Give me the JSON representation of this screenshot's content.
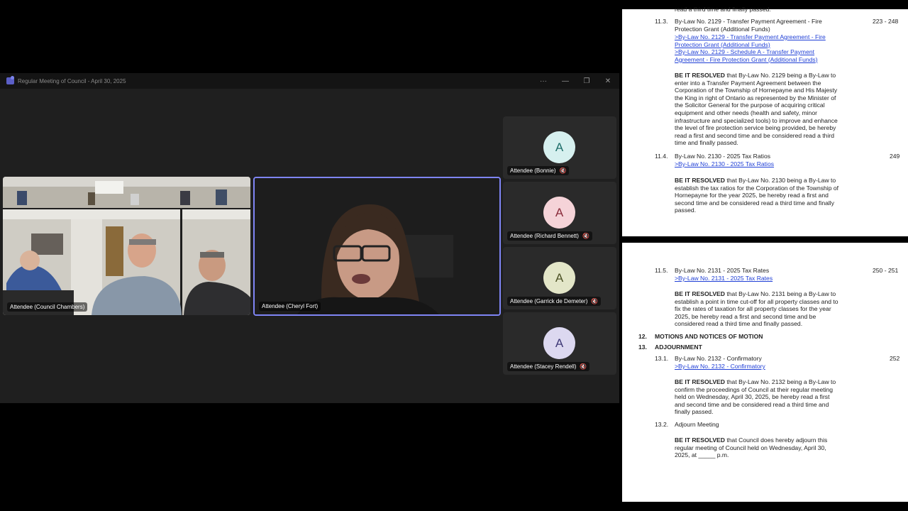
{
  "window": {
    "title": "Regular Meeting of Council - April 30, 2025",
    "controls": [
      "···",
      "—",
      "❐",
      "✕"
    ]
  },
  "tiles": {
    "chambers": {
      "name": "Attendee (Council Chambers)"
    },
    "cheryl": {
      "name": "Attendee (Cheryl Fort)"
    }
  },
  "side_tiles": [
    {
      "name": "Attendee (Bonnie)",
      "initial": "A",
      "avatar_bg": "#d6f0ef",
      "avatar_fg": "#1f6e6a"
    },
    {
      "name": "Attendee (Richard Bennett)",
      "initial": "A",
      "avatar_bg": "#f5d3d8",
      "avatar_fg": "#8a2c3b"
    },
    {
      "name": "Attendee (Garrick de Demeter)",
      "initial": "A",
      "avatar_bg": "#e3e6c8",
      "avatar_fg": "#4d5226"
    },
    {
      "name": "Attendee (Stacey Rendell)",
      "initial": "A",
      "avatar_bg": "#dcd8f0",
      "avatar_fg": "#403a78"
    }
  ],
  "doc_top": {
    "cut_line": "read a third time and finally passed.",
    "item_11_3": {
      "num": "11.3.",
      "title_1": "By-Law No. 2129 - Transfer Payment Agreement - Fire",
      "title_2": "Protection Grant (Additional Funds)",
      "pages": "223 - 248",
      "link1_1": ">By-Law No. 2129 - Transfer Payment Agreement - Fire",
      "link1_2": "Protection Grant (Additional Funds)",
      "link2_1": ">By-Law No. 2129 - Schedule A - Transfer Payment",
      "link2_2": "Agreement - Fire Protection Grant (Additional Funds)",
      "res_bold": "BE IT RESOLVED",
      "res_1": " that By-Law No. 2129 being a By-Law to",
      "res_lines": [
        "enter into a Transfer Payment Agreement between the",
        "Corporation of the Township of Hornepayne and His Majesty",
        "the King in right of Ontario as represented by the Minister of",
        "the Solicitor General for the purpose of acquiring critical",
        "equipment and other needs (health and safety, minor",
        "infrastructure and specialized tools) to improve and enhance",
        "the level of fire protection service being provided, be hereby",
        "read a first and second time and be considered read a third",
        "time and finally passed."
      ]
    },
    "item_11_4": {
      "num": "11.4.",
      "title": "By-Law No. 2130 - 2025 Tax Ratios",
      "pages": "249",
      "link": ">By-Law No. 2130 - 2025 Tax Ratios",
      "res_bold": "BE IT RESOLVED",
      "res_1": " that By-Law No. 2130 being a By-Law to",
      "res_lines": [
        "establish the tax ratios for the Corporation of the Township of",
        "Hornepayne for the year 2025, be hereby read a first and",
        "second time and be considered read a third time and finally",
        "passed."
      ]
    }
  },
  "doc_bottom": {
    "item_11_5": {
      "num": "11.5.",
      "title": "By-Law No. 2131 - 2025 Tax Rates",
      "pages": "250 - 251",
      "link": ">By-Law No. 2131 - 2025 Tax Rates",
      "res_bold": "BE IT RESOLVED",
      "res_1": " that By-Law No. 2131 being a By-Law to",
      "res_lines": [
        "establish a point in time cut-off for all property classes and to",
        "fix the rates of taxation for all property classes for the year",
        "2025, be hereby read a first and second time and be",
        "considered read a third time and finally passed."
      ]
    },
    "section_12": {
      "num": "12.",
      "title": "MOTIONS AND NOTICES OF MOTION"
    },
    "section_13": {
      "num": "13.",
      "title": "ADJOURNMENT"
    },
    "item_13_1": {
      "num": "13.1.",
      "title": "By-Law No. 2132 - Confirmatory",
      "pages": "252",
      "link": ">By-Law No. 2132 - Confirmatory",
      "res_bold": "BE IT RESOLVED",
      "res_1": " that By-Law No. 2132 being a By-Law to",
      "res_lines": [
        "confirm the proceedings of Council at their regular meeting",
        "held on Wednesday, April 30, 2025, be hereby read a first",
        "and second time and be considered read a third time and",
        "finally passed."
      ]
    },
    "item_13_2": {
      "num": "13.2.",
      "title": "Adjourn Meeting",
      "res_bold": "BE IT RESOLVED",
      "res_1": " that Council does hereby adjourn this",
      "res_lines": [
        "regular meeting of Council held on Wednesday, April 30,",
        "2025, at _____ p.m."
      ]
    }
  }
}
